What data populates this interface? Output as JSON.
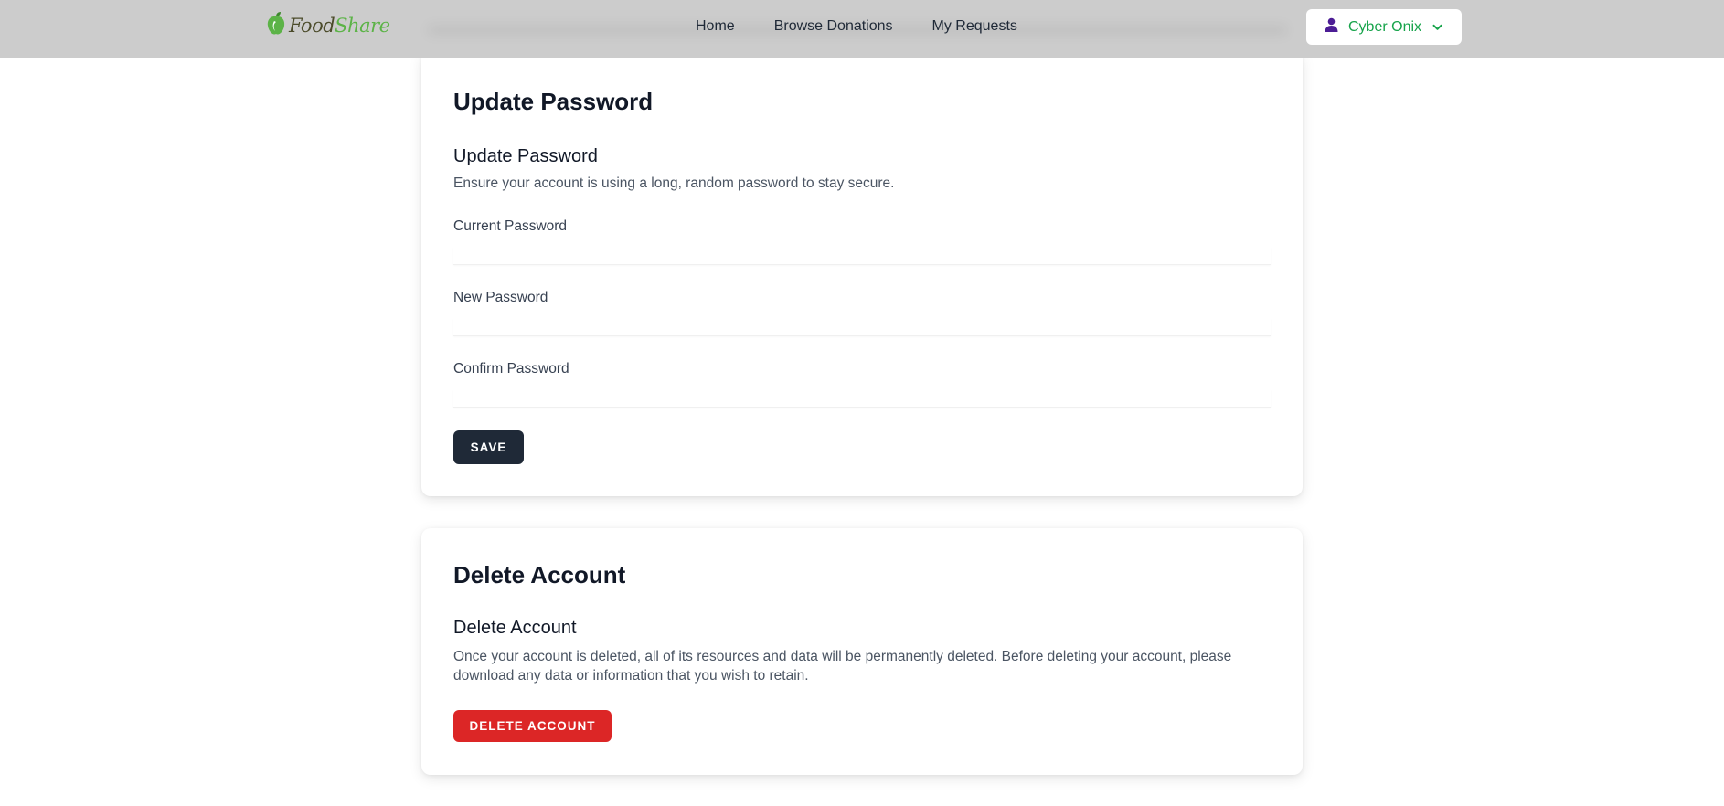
{
  "nav": {
    "logo_text_1": "Food",
    "logo_text_2": "Share",
    "links": [
      "Home",
      "Browse Donations",
      "My Requests"
    ],
    "user_name": "Cyber Onix"
  },
  "update_password": {
    "heading": "Update Password",
    "section_title": "Update Password",
    "description": "Ensure your account is using a long, random password to stay secure.",
    "current_label": "Current Password",
    "current_value": "",
    "new_label": "New Password",
    "new_value": "",
    "confirm_label": "Confirm Password",
    "confirm_value": "",
    "save_label": "SAVE"
  },
  "delete_account": {
    "heading": "Delete Account",
    "section_title": "Delete Account",
    "description": "Once your account is deleted, all of its resources and data will be permanently deleted. Before deleting your account, please download any data or information that you wish to retain.",
    "button_label": "DELETE ACCOUNT"
  },
  "colors": {
    "nav_bg": "#cccccc",
    "accent_green": "#16a34a",
    "save_bg": "#1f2937",
    "danger": "#dc2626",
    "user_icon": "#4c1d95"
  },
  "icons": {
    "logo": "apple-leaf-icon",
    "user": "user-icon",
    "dropdown": "chevron-down-icon"
  }
}
